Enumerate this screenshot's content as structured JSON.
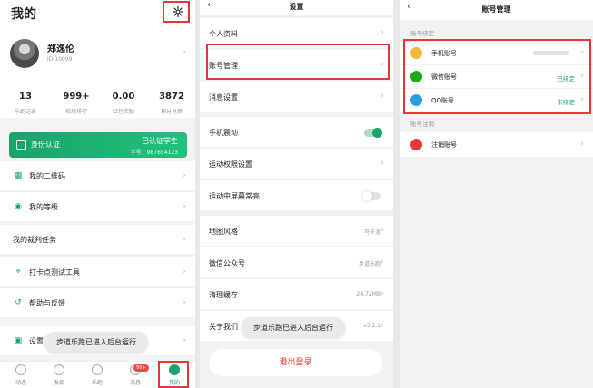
{
  "profile": {
    "title": "我的",
    "settings_icon": "gear-icon",
    "user": {
      "name": "郑逸伦",
      "id": "ID:10099"
    },
    "stats": [
      {
        "value": "13",
        "label": "乐跑记录"
      },
      {
        "value": "999+",
        "label": "校周排行"
      },
      {
        "value": "0.00",
        "label": "红包奖励"
      },
      {
        "value": "3872",
        "label": "积分兑换"
      }
    ],
    "id_card": {
      "label": "身份认证",
      "status": "已认证学生",
      "student_no": "学号：987654123"
    },
    "menu": [
      {
        "label": "我的二维码",
        "icon": "qrcode-icon"
      },
      {
        "label": "我的等级",
        "icon": "badge-icon"
      },
      {
        "label": "我的裁判任务",
        "icon": ""
      },
      {
        "label": "打卡点测试工具",
        "icon": "location-icon"
      },
      {
        "label": "帮助与反馈",
        "icon": "help-icon"
      },
      {
        "label": "设置",
        "icon": "toolbox-icon"
      }
    ],
    "toast": "步道乐跑已进入后台运行",
    "tabs": [
      {
        "label": "动态",
        "icon": "planet-icon"
      },
      {
        "label": "发现",
        "icon": "compass-icon"
      },
      {
        "label": "乐跑",
        "icon": "shoe-icon"
      },
      {
        "label": "消息",
        "icon": "message-icon",
        "badge": "99+"
      },
      {
        "label": "我的",
        "icon": "smile-icon",
        "active": true
      }
    ]
  },
  "settings": {
    "title": "设置",
    "rows": [
      {
        "label": "个人资料"
      },
      {
        "label": "账号管理"
      },
      {
        "label": "消息设置"
      },
      {
        "label": "手机震动",
        "toggle": "on"
      },
      {
        "label": "运动权限设置"
      },
      {
        "label": "运动中屏幕常亮",
        "toggle": "off"
      },
      {
        "label": "地图风格",
        "value": "马卡龙"
      },
      {
        "label": "微信公众号",
        "value": "步道乐跑"
      },
      {
        "label": "清理缓存",
        "value": "24.72MB"
      },
      {
        "label": "关于我们",
        "value": "v3.2.1"
      }
    ],
    "toast": "步道乐跑已进入后台运行",
    "logout": "退出登录"
  },
  "account": {
    "title": "账号管理",
    "binding_section": "账号绑定",
    "bindings": [
      {
        "label": "手机账号",
        "status": "",
        "icon": "phone-icon",
        "color": "#f3b83a"
      },
      {
        "label": "微信账号",
        "status": "已绑定",
        "icon": "wechat-icon",
        "color": "#1aad19"
      },
      {
        "label": "QQ账号",
        "status": "未绑定",
        "icon": "qq-icon",
        "color": "#2a9fe0"
      }
    ],
    "cancel_section": "账号注销",
    "cancel_label": "注销账号"
  },
  "colors": {
    "brand": "#1aa36a",
    "highlight": "#e5383b"
  }
}
